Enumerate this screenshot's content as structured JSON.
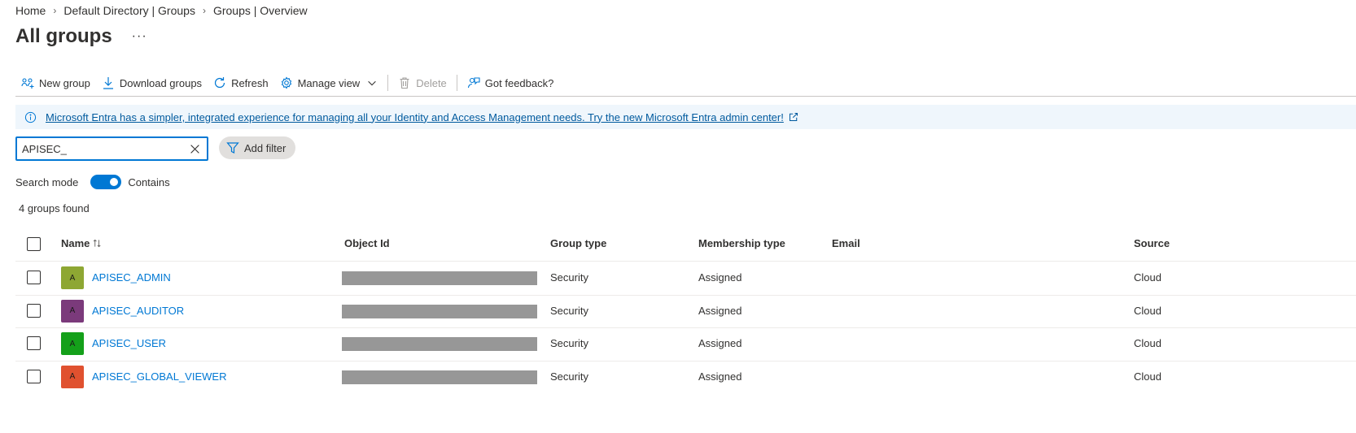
{
  "breadcrumb": [
    "Home",
    "Default Directory | Groups",
    "Groups | Overview"
  ],
  "page": {
    "title": "All groups",
    "more": "···"
  },
  "toolbar": {
    "new_group": "New group",
    "download": "Download groups",
    "refresh": "Refresh",
    "manage_view": "Manage view",
    "delete": "Delete",
    "feedback": "Got feedback?"
  },
  "banner": {
    "text": "Microsoft Entra has a simpler, integrated experience for managing all your Identity and Access Management needs. Try the new Microsoft Entra admin center!"
  },
  "search": {
    "value": "APISEC_"
  },
  "filter": {
    "add_label": "Add filter"
  },
  "search_mode": {
    "label": "Search mode",
    "value": "Contains",
    "on": true
  },
  "results": {
    "count_text": "4 groups found"
  },
  "table": {
    "headers": {
      "name": "Name",
      "object_id": "Object Id",
      "group_type": "Group type",
      "membership_type": "Membership type",
      "email": "Email",
      "source": "Source"
    },
    "rows": [
      {
        "initial": "A",
        "color": "#8ea733",
        "name": "APISEC_ADMIN",
        "group_type": "Security",
        "membership_type": "Assigned",
        "email": "",
        "source": "Cloud"
      },
      {
        "initial": "A",
        "color": "#7b3a7b",
        "name": "APISEC_AUDITOR",
        "group_type": "Security",
        "membership_type": "Assigned",
        "email": "",
        "source": "Cloud"
      },
      {
        "initial": "A",
        "color": "#14a01a",
        "name": "APISEC_USER",
        "group_type": "Security",
        "membership_type": "Assigned",
        "email": "",
        "source": "Cloud"
      },
      {
        "initial": "A",
        "color": "#e0512f",
        "name": "APISEC_GLOBAL_VIEWER",
        "group_type": "Security",
        "membership_type": "Assigned",
        "email": "",
        "source": "Cloud"
      }
    ]
  },
  "colors": {
    "accent": "#0078d4",
    "link": "#005a9e",
    "banner_bg": "#eff6fc",
    "redaction": "#979797"
  }
}
